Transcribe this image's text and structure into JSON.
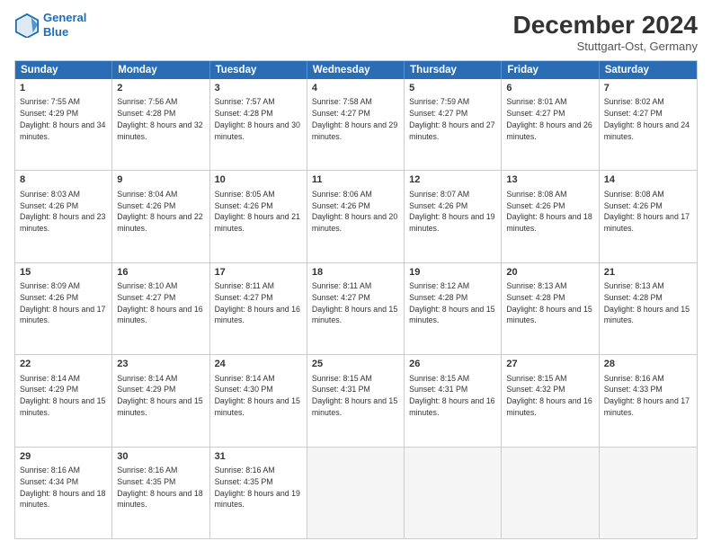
{
  "header": {
    "logo_line1": "General",
    "logo_line2": "Blue",
    "month": "December 2024",
    "location": "Stuttgart-Ost, Germany"
  },
  "days_of_week": [
    "Sunday",
    "Monday",
    "Tuesday",
    "Wednesday",
    "Thursday",
    "Friday",
    "Saturday"
  ],
  "weeks": [
    [
      {
        "day": "1",
        "info": "Sunrise: 7:55 AM\nSunset: 4:29 PM\nDaylight: 8 hours\nand 34 minutes."
      },
      {
        "day": "2",
        "info": "Sunrise: 7:56 AM\nSunset: 4:28 PM\nDaylight: 8 hours\nand 32 minutes."
      },
      {
        "day": "3",
        "info": "Sunrise: 7:57 AM\nSunset: 4:28 PM\nDaylight: 8 hours\nand 30 minutes."
      },
      {
        "day": "4",
        "info": "Sunrise: 7:58 AM\nSunset: 4:27 PM\nDaylight: 8 hours\nand 29 minutes."
      },
      {
        "day": "5",
        "info": "Sunrise: 7:59 AM\nSunset: 4:27 PM\nDaylight: 8 hours\nand 27 minutes."
      },
      {
        "day": "6",
        "info": "Sunrise: 8:01 AM\nSunset: 4:27 PM\nDaylight: 8 hours\nand 26 minutes."
      },
      {
        "day": "7",
        "info": "Sunrise: 8:02 AM\nSunset: 4:27 PM\nDaylight: 8 hours\nand 24 minutes."
      }
    ],
    [
      {
        "day": "8",
        "info": "Sunrise: 8:03 AM\nSunset: 4:26 PM\nDaylight: 8 hours\nand 23 minutes."
      },
      {
        "day": "9",
        "info": "Sunrise: 8:04 AM\nSunset: 4:26 PM\nDaylight: 8 hours\nand 22 minutes."
      },
      {
        "day": "10",
        "info": "Sunrise: 8:05 AM\nSunset: 4:26 PM\nDaylight: 8 hours\nand 21 minutes."
      },
      {
        "day": "11",
        "info": "Sunrise: 8:06 AM\nSunset: 4:26 PM\nDaylight: 8 hours\nand 20 minutes."
      },
      {
        "day": "12",
        "info": "Sunrise: 8:07 AM\nSunset: 4:26 PM\nDaylight: 8 hours\nand 19 minutes."
      },
      {
        "day": "13",
        "info": "Sunrise: 8:08 AM\nSunset: 4:26 PM\nDaylight: 8 hours\nand 18 minutes."
      },
      {
        "day": "14",
        "info": "Sunrise: 8:08 AM\nSunset: 4:26 PM\nDaylight: 8 hours\nand 17 minutes."
      }
    ],
    [
      {
        "day": "15",
        "info": "Sunrise: 8:09 AM\nSunset: 4:26 PM\nDaylight: 8 hours\nand 17 minutes."
      },
      {
        "day": "16",
        "info": "Sunrise: 8:10 AM\nSunset: 4:27 PM\nDaylight: 8 hours\nand 16 minutes."
      },
      {
        "day": "17",
        "info": "Sunrise: 8:11 AM\nSunset: 4:27 PM\nDaylight: 8 hours\nand 16 minutes."
      },
      {
        "day": "18",
        "info": "Sunrise: 8:11 AM\nSunset: 4:27 PM\nDaylight: 8 hours\nand 15 minutes."
      },
      {
        "day": "19",
        "info": "Sunrise: 8:12 AM\nSunset: 4:28 PM\nDaylight: 8 hours\nand 15 minutes."
      },
      {
        "day": "20",
        "info": "Sunrise: 8:13 AM\nSunset: 4:28 PM\nDaylight: 8 hours\nand 15 minutes."
      },
      {
        "day": "21",
        "info": "Sunrise: 8:13 AM\nSunset: 4:28 PM\nDaylight: 8 hours\nand 15 minutes."
      }
    ],
    [
      {
        "day": "22",
        "info": "Sunrise: 8:14 AM\nSunset: 4:29 PM\nDaylight: 8 hours\nand 15 minutes."
      },
      {
        "day": "23",
        "info": "Sunrise: 8:14 AM\nSunset: 4:29 PM\nDaylight: 8 hours\nand 15 minutes."
      },
      {
        "day": "24",
        "info": "Sunrise: 8:14 AM\nSunset: 4:30 PM\nDaylight: 8 hours\nand 15 minutes."
      },
      {
        "day": "25",
        "info": "Sunrise: 8:15 AM\nSunset: 4:31 PM\nDaylight: 8 hours\nand 15 minutes."
      },
      {
        "day": "26",
        "info": "Sunrise: 8:15 AM\nSunset: 4:31 PM\nDaylight: 8 hours\nand 16 minutes."
      },
      {
        "day": "27",
        "info": "Sunrise: 8:15 AM\nSunset: 4:32 PM\nDaylight: 8 hours\nand 16 minutes."
      },
      {
        "day": "28",
        "info": "Sunrise: 8:16 AM\nSunset: 4:33 PM\nDaylight: 8 hours\nand 17 minutes."
      }
    ],
    [
      {
        "day": "29",
        "info": "Sunrise: 8:16 AM\nSunset: 4:34 PM\nDaylight: 8 hours\nand 18 minutes."
      },
      {
        "day": "30",
        "info": "Sunrise: 8:16 AM\nSunset: 4:35 PM\nDaylight: 8 hours\nand 18 minutes."
      },
      {
        "day": "31",
        "info": "Sunrise: 8:16 AM\nSunset: 4:35 PM\nDaylight: 8 hours\nand 19 minutes."
      },
      {
        "day": "",
        "info": ""
      },
      {
        "day": "",
        "info": ""
      },
      {
        "day": "",
        "info": ""
      },
      {
        "day": "",
        "info": ""
      }
    ]
  ]
}
